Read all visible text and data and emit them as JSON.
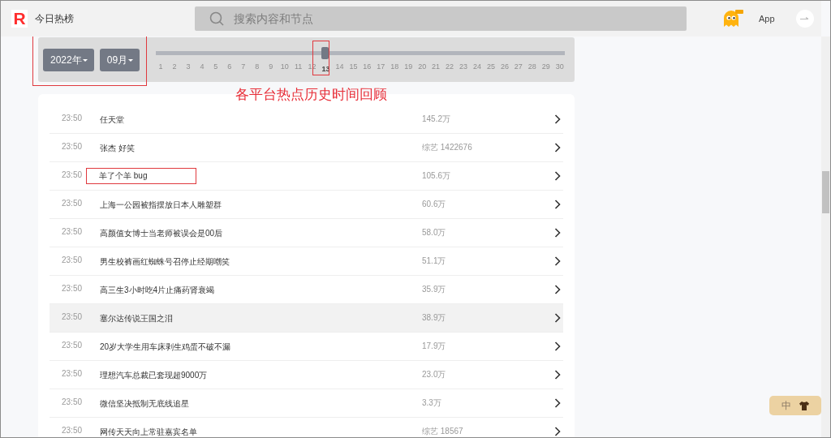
{
  "header": {
    "logo": "R",
    "title": "今日热榜",
    "search": {
      "placeholder": "搜索内容和节点"
    },
    "app_link": "App"
  },
  "date_picker": {
    "year": "2022年",
    "month": "09月",
    "level": 0.4138,
    "days": [
      {
        "label": "1",
        "selected": false
      },
      {
        "label": "2",
        "selected": false
      },
      {
        "label": "3",
        "selected": false
      },
      {
        "label": "4",
        "selected": false
      },
      {
        "label": "5",
        "selected": false
      },
      {
        "label": "6",
        "selected": false
      },
      {
        "label": "7",
        "selected": false
      },
      {
        "label": "8",
        "selected": false
      },
      {
        "label": "9",
        "selected": false
      },
      {
        "label": "10",
        "selected": false
      },
      {
        "label": "11",
        "selected": false
      },
      {
        "label": "12",
        "selected": false
      },
      {
        "label": "13",
        "selected": true
      },
      {
        "label": "14",
        "selected": false
      },
      {
        "label": "15",
        "selected": false
      },
      {
        "label": "16",
        "selected": false
      },
      {
        "label": "17",
        "selected": false
      },
      {
        "label": "18",
        "selected": false
      },
      {
        "label": "19",
        "selected": false
      },
      {
        "label": "20",
        "selected": false
      },
      {
        "label": "21",
        "selected": false
      },
      {
        "label": "22",
        "selected": false
      },
      {
        "label": "23",
        "selected": false
      },
      {
        "label": "24",
        "selected": false
      },
      {
        "label": "25",
        "selected": false
      },
      {
        "label": "26",
        "selected": false
      },
      {
        "label": "27",
        "selected": false
      },
      {
        "label": "28",
        "selected": false
      },
      {
        "label": "29",
        "selected": false
      },
      {
        "label": "30",
        "selected": false
      }
    ]
  },
  "annotation": {
    "caption": "各平台热点历史时间回顾"
  },
  "list": [
    {
      "time": "23:50",
      "title": "任天堂",
      "count": "145.2万",
      "highlighted": false,
      "boxed": false
    },
    {
      "time": "23:50",
      "title": "张杰 好笑",
      "count": "综艺 1422676",
      "highlighted": false,
      "boxed": false
    },
    {
      "time": "23:50",
      "title": "羊了个羊 bug",
      "count": "105.6万",
      "highlighted": false,
      "boxed": true
    },
    {
      "time": "23:50",
      "title": "上海一公园被指摆放日本人雕塑群",
      "count": "60.6万",
      "highlighted": false,
      "boxed": false
    },
    {
      "time": "23:50",
      "title": "高颜值女博士当老师被误会是00后",
      "count": "58.0万",
      "highlighted": false,
      "boxed": false
    },
    {
      "time": "23:50",
      "title": "男生校裤画红蜘蛛号召停止经期嘲笑",
      "count": "51.1万",
      "highlighted": false,
      "boxed": false
    },
    {
      "time": "23:50",
      "title": "高三生3小时吃4片止痛药肾衰竭",
      "count": "35.9万",
      "highlighted": false,
      "boxed": false
    },
    {
      "time": "23:50",
      "title": "塞尔达传说王国之泪",
      "count": "38.9万",
      "highlighted": true,
      "boxed": false
    },
    {
      "time": "23:50",
      "title": "20岁大学生用车床剥生鸡蛋不破不漏",
      "count": "17.9万",
      "highlighted": false,
      "boxed": false
    },
    {
      "time": "23:50",
      "title": "理想汽车总裁已套现超9000万",
      "count": "23.0万",
      "highlighted": false,
      "boxed": false
    },
    {
      "time": "23:50",
      "title": "微信坚决抵制无底线追星",
      "count": "3.3万",
      "highlighted": false,
      "boxed": false
    },
    {
      "time": "23:50",
      "title": "网传天天向上常驻嘉宾名单",
      "count": "综艺 18567",
      "highlighted": false,
      "boxed": false
    }
  ],
  "float_tag": {
    "label": "中"
  }
}
